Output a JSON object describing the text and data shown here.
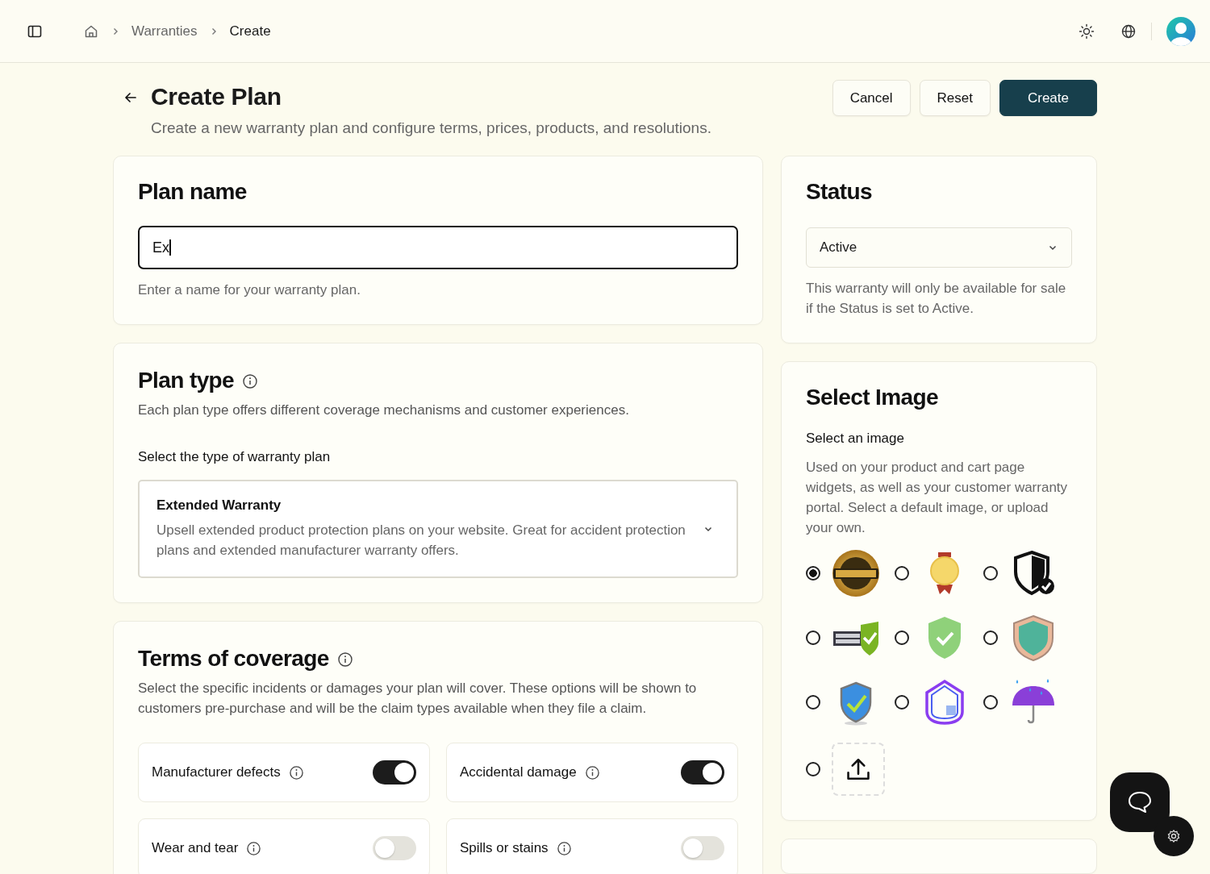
{
  "breadcrumbs": [
    {
      "label": "Warranties",
      "current": false
    },
    {
      "label": "Create",
      "current": true
    }
  ],
  "page": {
    "title": "Create Plan",
    "subtitle": "Create a new warranty plan and configure terms, prices, products, and resolutions."
  },
  "actions": [
    {
      "label": "Cancel",
      "kind": "secondary"
    },
    {
      "label": "Reset",
      "kind": "secondary"
    },
    {
      "label": "Create",
      "kind": "primary"
    }
  ],
  "plan_name": {
    "title": "Plan name",
    "value": "Ex",
    "focused": true,
    "hint": "Enter a name for your warranty plan."
  },
  "plan_type": {
    "title": "Plan type",
    "description": "Each plan type offers different coverage mechanisms and customer experiences.",
    "label": "Select the type of warranty plan",
    "option_title": "Extended Warranty",
    "option_description": "Upsell extended product protection plans on your website. Great for accident protection plans and extended manufacturer warranty offers."
  },
  "terms": {
    "title": "Terms of coverage",
    "description": "Select the specific incidents or damages your plan will cover. These options will be shown to customers pre-purchase and will be the claim types available when they file a claim.",
    "items": [
      {
        "label": "Manufacturer defects",
        "on": true
      },
      {
        "label": "Accidental damage",
        "on": true
      },
      {
        "label": "Wear and tear",
        "on": false
      },
      {
        "label": "Spills or stains",
        "on": false
      }
    ]
  },
  "status": {
    "title": "Status",
    "value": "Active",
    "help": "This warranty will only be available for sale if the Status is set to Active."
  },
  "select_image": {
    "title": "Select Image",
    "label": "Select an image",
    "description": "Used on your product and cart page widgets, as well as your customer warranty portal. Select a default image, or upload your own.",
    "options": [
      {
        "kind": "seal",
        "selected": true
      },
      {
        "kind": "medal",
        "selected": false
      },
      {
        "kind": "guard",
        "selected": false
      },
      {
        "kind": "label",
        "selected": false
      },
      {
        "kind": "shield",
        "selected": false
      },
      {
        "kind": "crest",
        "selected": false
      },
      {
        "kind": "badge",
        "selected": false
      },
      {
        "kind": "house",
        "selected": false
      },
      {
        "kind": "umbrella",
        "selected": false
      },
      {
        "kind": "upload",
        "selected": false
      }
    ]
  }
}
